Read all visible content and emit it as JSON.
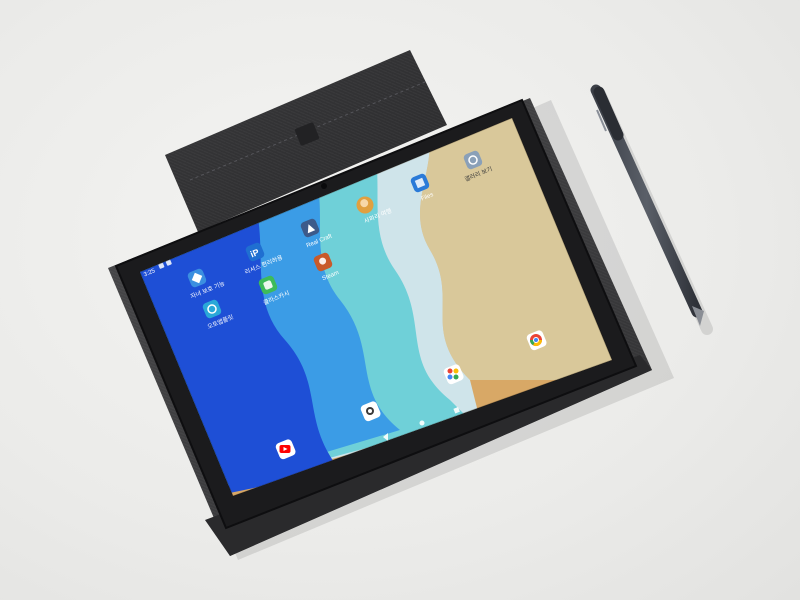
{
  "status_bar": {
    "time": "3:25"
  },
  "home_screen": {
    "apps": [
      {
        "id": "app1",
        "label": "자녀 보호 기능",
        "icon": "diamond-icon",
        "color": "#3b8fe0"
      },
      {
        "id": "app2",
        "label": "오토앱플릿",
        "icon": "sync-icon",
        "color": "#2aa8d8"
      },
      {
        "id": "app3",
        "label": "리서스 편리하용",
        "icon": "ip-icon",
        "color": "#1f6fd1"
      },
      {
        "id": "app4",
        "label": "클라스카시",
        "icon": "android-icon",
        "color": "#3dbb5a"
      },
      {
        "id": "app5",
        "label": "Real Craft",
        "icon": "craft-icon",
        "color": "#3d5a8a"
      },
      {
        "id": "app6",
        "label": "Steam",
        "icon": "game-icon",
        "color": "#c85a2a"
      },
      {
        "id": "app7",
        "label": "사파리 여행",
        "icon": "avatar-icon",
        "color": "#e0a040"
      },
      {
        "id": "app8",
        "label": "Files",
        "icon": "files-icon",
        "color": "#2a7ad8"
      },
      {
        "id": "app9",
        "label": "갤러리 보기",
        "icon": "gallery-icon",
        "color": "#8aa0b8"
      }
    ],
    "dock": [
      {
        "id": "chrome",
        "icon": "chrome-icon"
      },
      {
        "id": "photos",
        "icon": "photos-icon"
      },
      {
        "id": "camera",
        "icon": "camera-icon"
      },
      {
        "id": "youtube",
        "icon": "youtube-icon"
      }
    ]
  },
  "colors": {
    "wallpaper_blue": "#1e4fd6",
    "wallpaper_sky": "#3b9ce6",
    "wallpaper_teal": "#6fd0d8",
    "wallpaper_pale": "#cfe4ea",
    "wallpaper_sand": "#d9c89a",
    "wallpaper_tan": "#d8a866",
    "case_color": "#3a3a3c"
  }
}
